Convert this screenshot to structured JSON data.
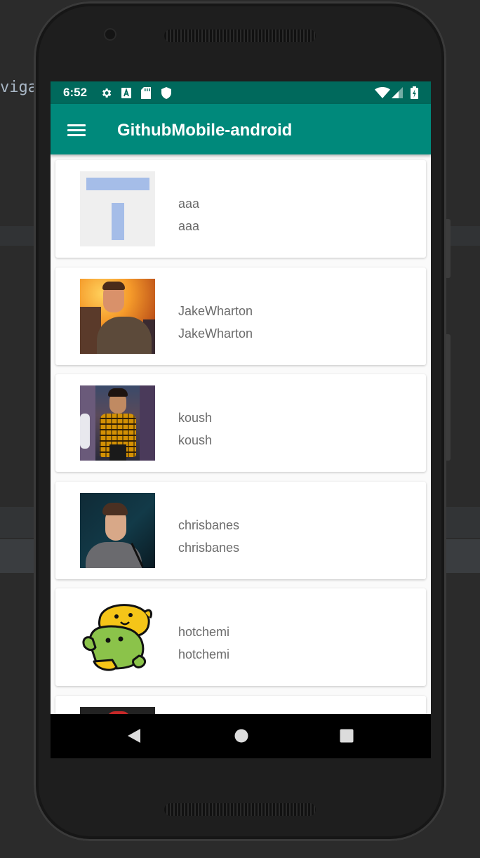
{
  "ide": {
    "text": "viga"
  },
  "status_bar": {
    "time": "6:52",
    "left_icons": [
      "gear-icon",
      "a-box-icon",
      "sd-card-icon",
      "shield-icon"
    ],
    "right_icons": [
      "wifi-icon",
      "cell-signal-icon",
      "battery-charging-icon"
    ]
  },
  "app_bar": {
    "title": "GithubMobile-android",
    "menu_icon": "hamburger-menu-icon"
  },
  "users": [
    {
      "login": "aaa",
      "name": "aaa",
      "avatar": "placeholder-t-avatar"
    },
    {
      "login": "JakeWharton",
      "name": "JakeWharton",
      "avatar": "photo-man-hoodie"
    },
    {
      "login": "koush",
      "name": "koush",
      "avatar": "photo-boy-plaid-shirt"
    },
    {
      "login": "chrisbanes",
      "name": "chrisbanes",
      "avatar": "photo-man-speaking"
    },
    {
      "login": "hotchemi",
      "name": "hotchemi",
      "avatar": "wapuu-android-illustration"
    }
  ],
  "nav_bar": {
    "icons": [
      "back-icon",
      "home-icon",
      "recents-icon"
    ]
  },
  "colors": {
    "status_bar": "#00695c",
    "app_bar": "#00897b",
    "card_text": "#6b6b6b"
  }
}
